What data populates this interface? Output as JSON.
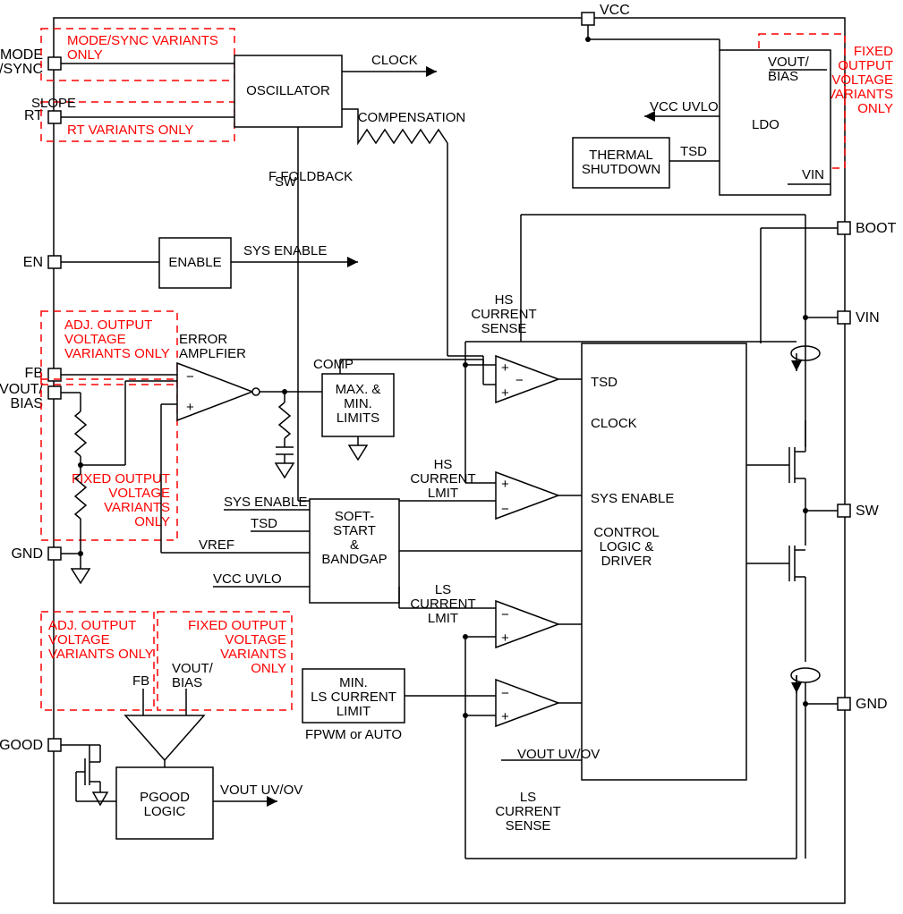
{
  "pins": {
    "mode_sync": "MODE\n/SYNC",
    "rt": "RT",
    "en": "EN",
    "fb": "FB",
    "vout_bias": "VOUT/\nBIAS",
    "gnd": "GND",
    "pgood": "PGOOD",
    "vcc": "VCC",
    "boot": "BOOT",
    "vin_right": "VIN",
    "sw": "SW",
    "gnd_right": "GND"
  },
  "blocks": {
    "oscillator": "OSCILLATOR",
    "enable": "ENABLE",
    "error_amp": "ERROR\nAMPLFIER",
    "max_min": "MAX. &\nMIN.\nLIMITS",
    "soft_start": "SOFT-\nSTART\n&\nBANDGAP",
    "min_ls": "MIN.\nLS CURRENT\nLIMIT",
    "pgood_logic": "PGOOD\nLOGIC",
    "thermal": "THERMAL\nSHUTDOWN",
    "ldo": "LDO",
    "control": "CONTROL\nLOGIC &\nDRIVER"
  },
  "signals": {
    "clock": "CLOCK",
    "slope": "SLOPE\nCOMPENSATION",
    "fsw_foldback": "F    FOLDBACK",
    "fsw_sub": "SW",
    "sys_enable": "SYS ENABLE",
    "comp": "COMP",
    "vref": "VREF",
    "sys_enable2": "SYS ENABLE",
    "tsd": "TSD",
    "vcc_uvlo": "VCC UVLO",
    "hs_sense": "HS\nCURRENT\nSENSE",
    "hs_limit": "HS\nCURRENT\nLMIT",
    "ls_limit": "LS\nCURRENT\nLMIT",
    "ls_sense": "LS\nCURRENT\nSENSE",
    "vout_uvov": "VOUT UV/OV",
    "fpwm": "FPWM or AUTO",
    "fb_small": "FB",
    "vout_bias_small": "VOUT/\nBIAS",
    "tsd_ldo": "TSD",
    "vcc_uvlo_ldo": "VCC UVLO",
    "vin_ldo": "VIN",
    "vout_bias_ldo": "VOUT/\nBIAS",
    "tsd_ctrl": "TSD",
    "clock_ctrl": "CLOCK",
    "sys_en_ctrl": "SYS ENABLE",
    "vout_uvov_ctrl": "VOUT UV/OV",
    "vout_uvov_pgood": "VOUT UV/OV"
  },
  "annotations": {
    "mode_sync_var": "MODE/SYNC VARIANTS\nONLY",
    "rt_var": "RT VARIANTS ONLY",
    "adj_out1": "ADJ. OUTPUT\nVOLTAGE\nVARIANTS ONLY",
    "fixed_out1": "FIXED OUTPUT\nVOLTAGE\nVARIANTS\nONLY",
    "adj_out2": "ADJ. OUTPUT\nVOLTAGE\nVARIANTS ONLY",
    "fixed_out2": "FIXED OUTPUT\nVOLTAGE\nVARIANTS\nONLY",
    "fixed_out3": "FIXED\nOUTPUT\nVOLTAGE\nVARIANTS\nONLY"
  }
}
